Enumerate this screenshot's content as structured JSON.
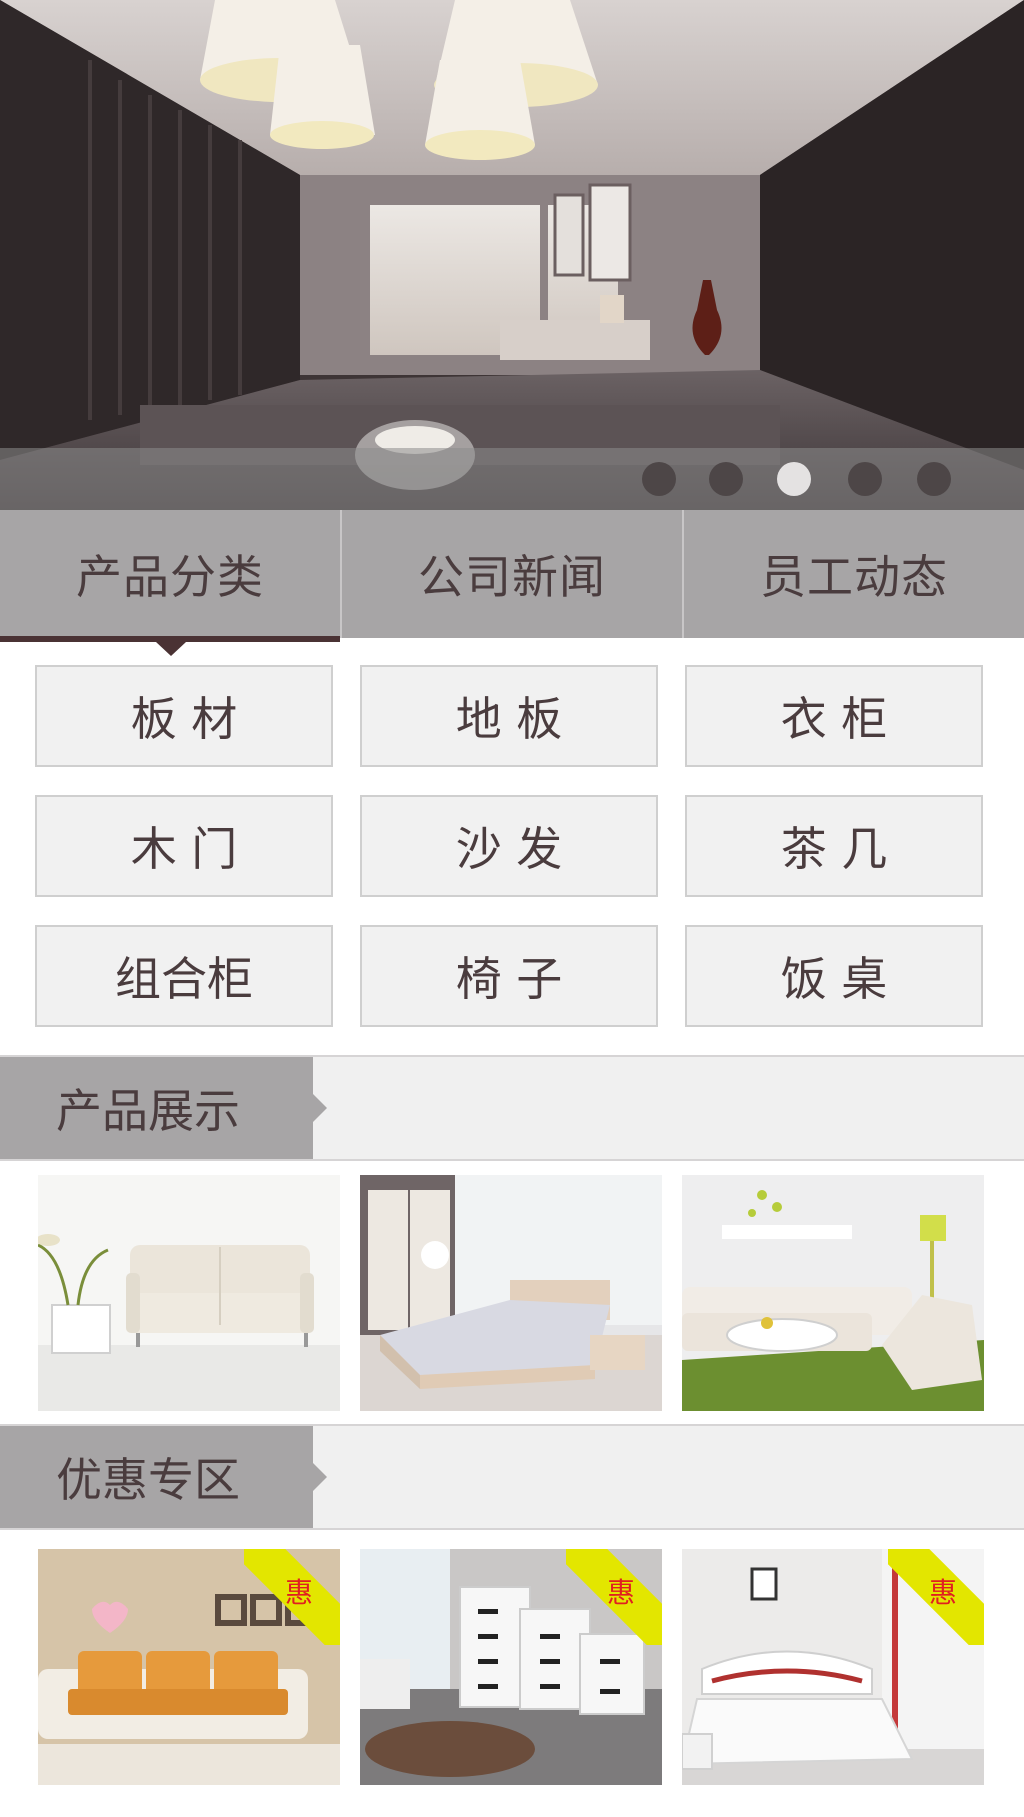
{
  "hero": {
    "slide_count": 5,
    "active_index": 2
  },
  "tabs": [
    {
      "label": "产品分类",
      "active": true
    },
    {
      "label": "公司新闻",
      "active": false
    },
    {
      "label": "员工动态",
      "active": false
    }
  ],
  "categories": [
    "板 材",
    "地 板",
    "衣 柜",
    "木 门",
    "沙 发",
    "茶 几",
    "组合柜",
    "椅 子",
    "饭 桌"
  ],
  "sections": {
    "products": {
      "title": "产品展示"
    },
    "deals": {
      "title": "优惠专区",
      "badge": "惠"
    }
  },
  "colors": {
    "tab_bg": "#a7a5a6",
    "active_indicator": "#4a3234",
    "text": "#4a3c3e",
    "badge_bg": "#e3e600",
    "badge_text": "#e02020"
  }
}
